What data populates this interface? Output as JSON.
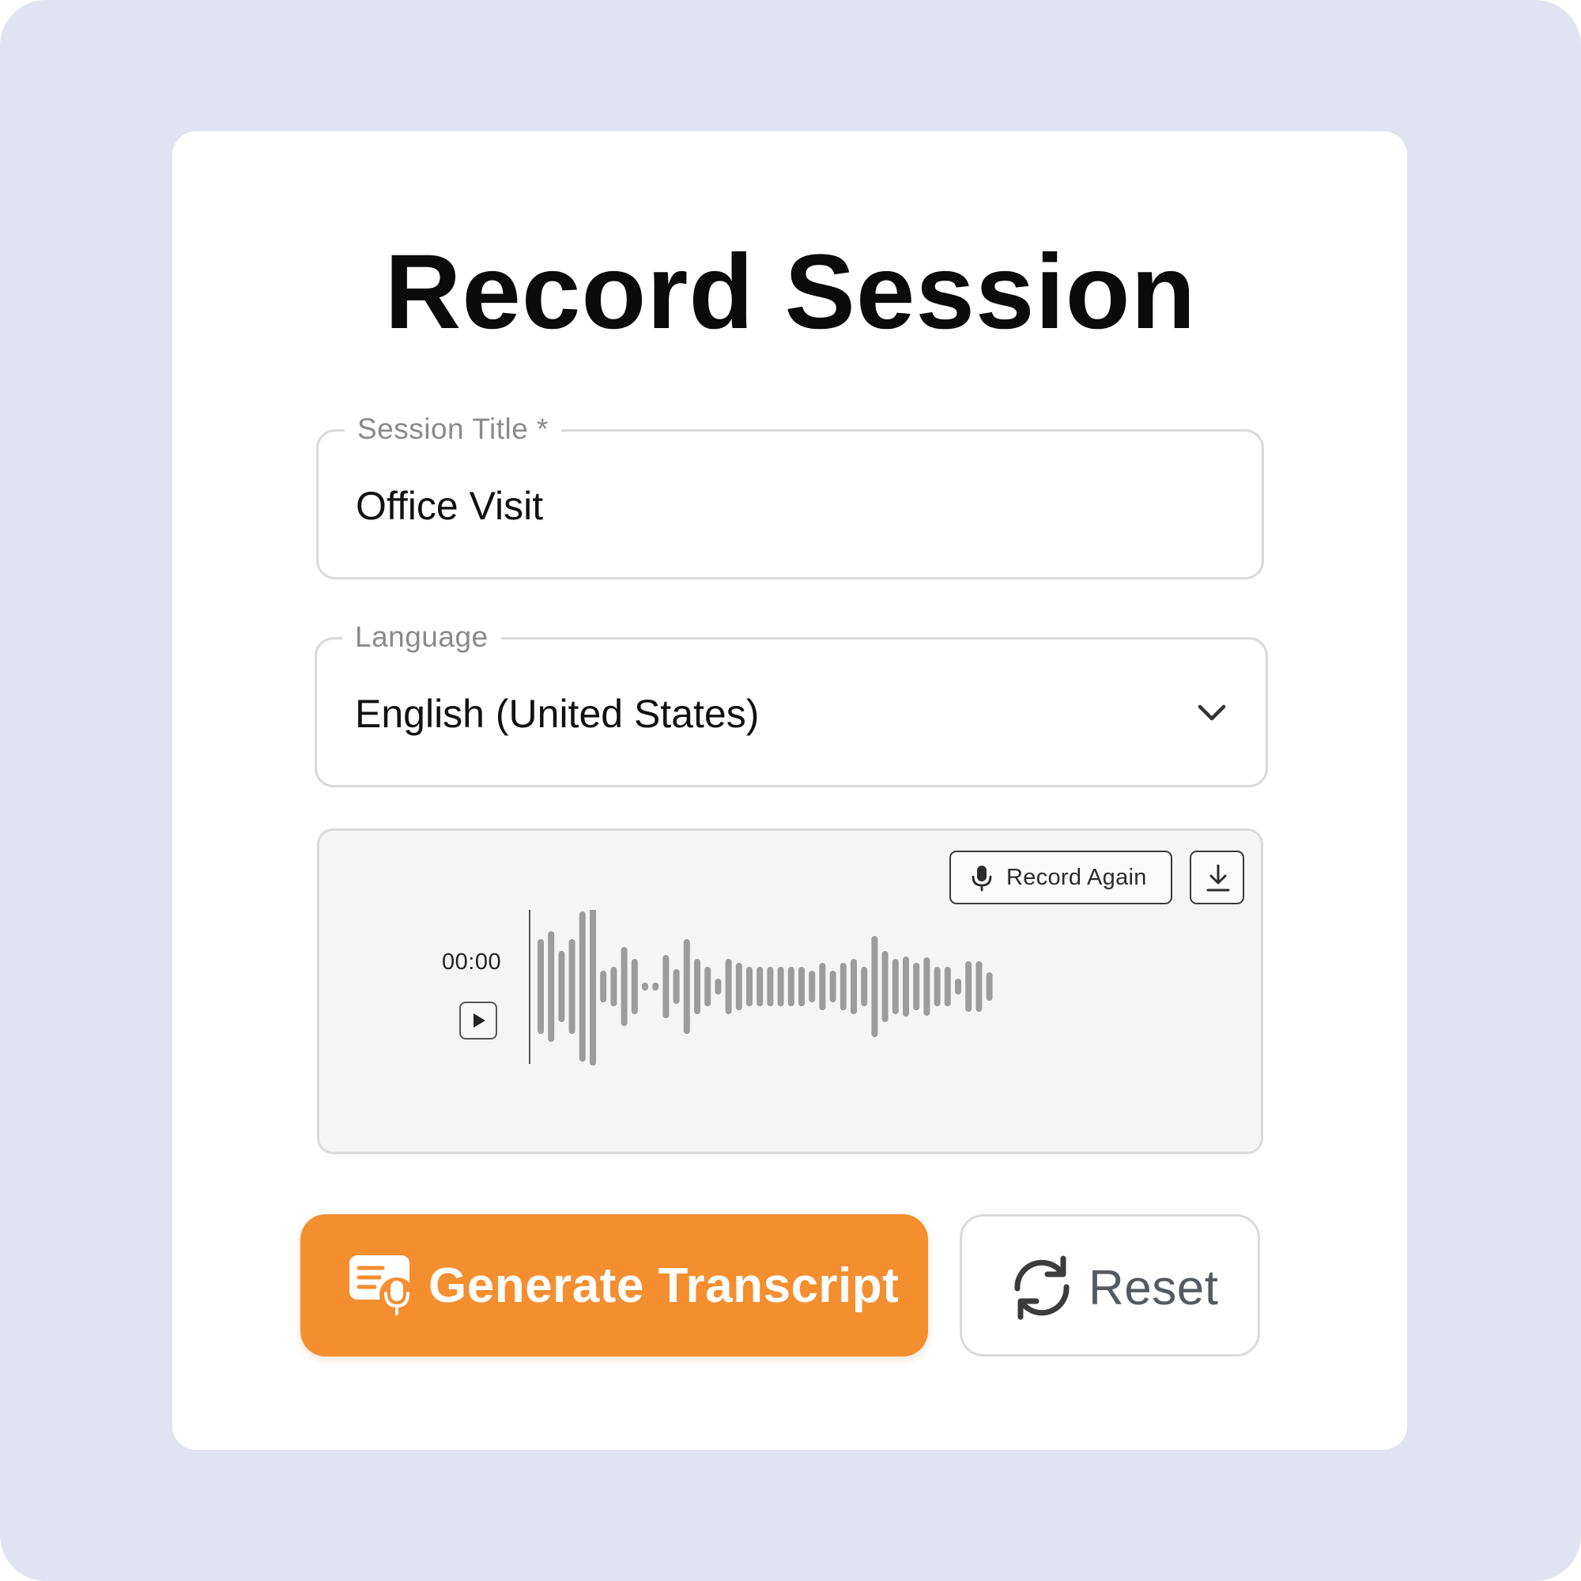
{
  "page": {
    "title": "Record Session"
  },
  "form": {
    "session_title": {
      "label": "Session Title *",
      "value": "Office Visit"
    },
    "language": {
      "label": "Language",
      "selected": "English (United States)"
    }
  },
  "recorder": {
    "record_again_label": "Record Again",
    "time": "00:00",
    "icons": {
      "record": "microphone-icon",
      "download": "download-icon",
      "play": "play-icon"
    }
  },
  "actions": {
    "generate_label": "Generate Transcript",
    "reset_label": "Reset",
    "icons": {
      "generate": "transcript-icon",
      "reset": "refresh-icon"
    }
  },
  "colors": {
    "background": "#e1e4f0",
    "accent": "#f48e2f",
    "waveform": "#9c9c9c"
  }
}
